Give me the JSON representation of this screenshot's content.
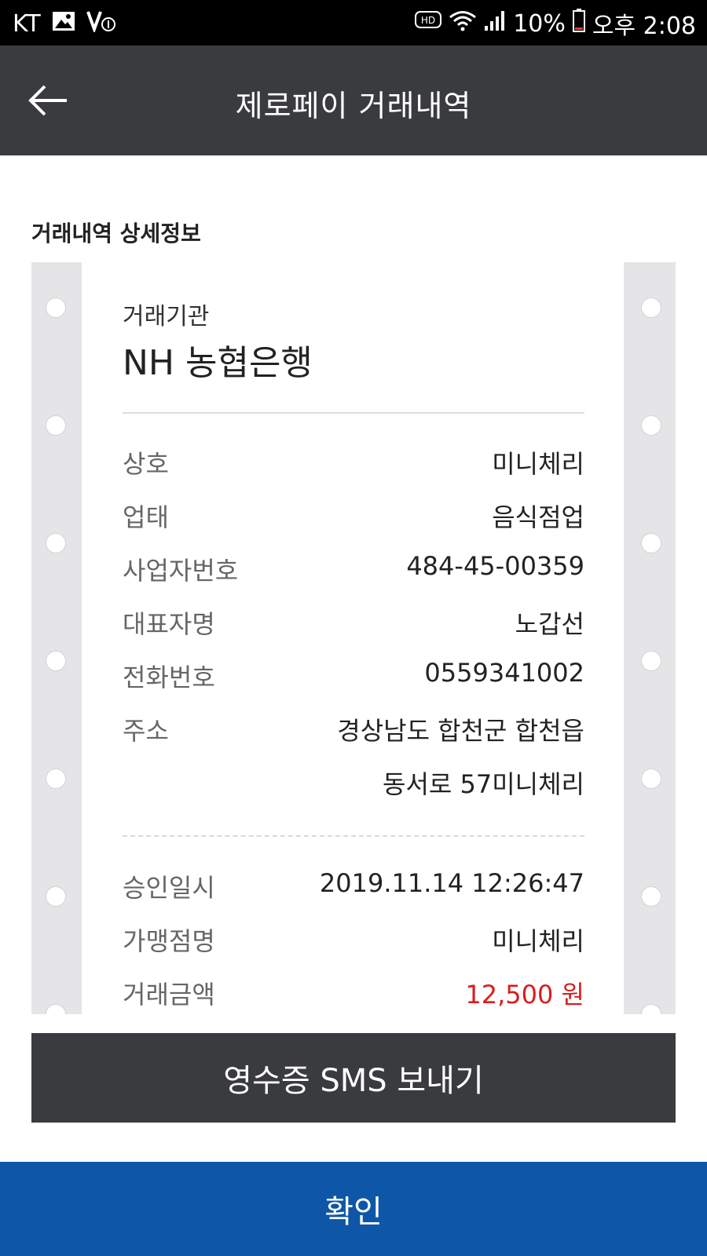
{
  "status_bar": {
    "carrier": "KT",
    "hd_label": "HD",
    "battery": "10%",
    "time": "오후 2:08"
  },
  "app_bar": {
    "title": "제로페이 거래내역"
  },
  "section_title": "거래내역 상세정보",
  "receipt": {
    "org_label": "거래기관",
    "org_name": "NH 농협은행",
    "merchant_rows": [
      {
        "label": "상호",
        "value": "미니체리"
      },
      {
        "label": "업태",
        "value": "음식점업"
      },
      {
        "label": "사업자번호",
        "value": "484-45-00359"
      },
      {
        "label": "대표자명",
        "value": "노갑선"
      },
      {
        "label": "전화번호",
        "value": "0559341002"
      },
      {
        "label": "주소",
        "value_line1": "경상남도 합천군 합천읍",
        "value_line2": "동서로 57미니체리"
      }
    ],
    "transaction_rows": [
      {
        "label": "승인일시",
        "value": "2019.11.14 12:26:47"
      },
      {
        "label": "가맹점명",
        "value": "미니체리"
      },
      {
        "label": "거래금액",
        "value": "12,500 원"
      }
    ]
  },
  "buttons": {
    "sms_label": "영수증 SMS 보내기",
    "confirm_label": "확인"
  },
  "colors": {
    "app_bar": "#3a3b3e",
    "confirm_button": "#0e57a8",
    "amount": "#d91d1d"
  }
}
